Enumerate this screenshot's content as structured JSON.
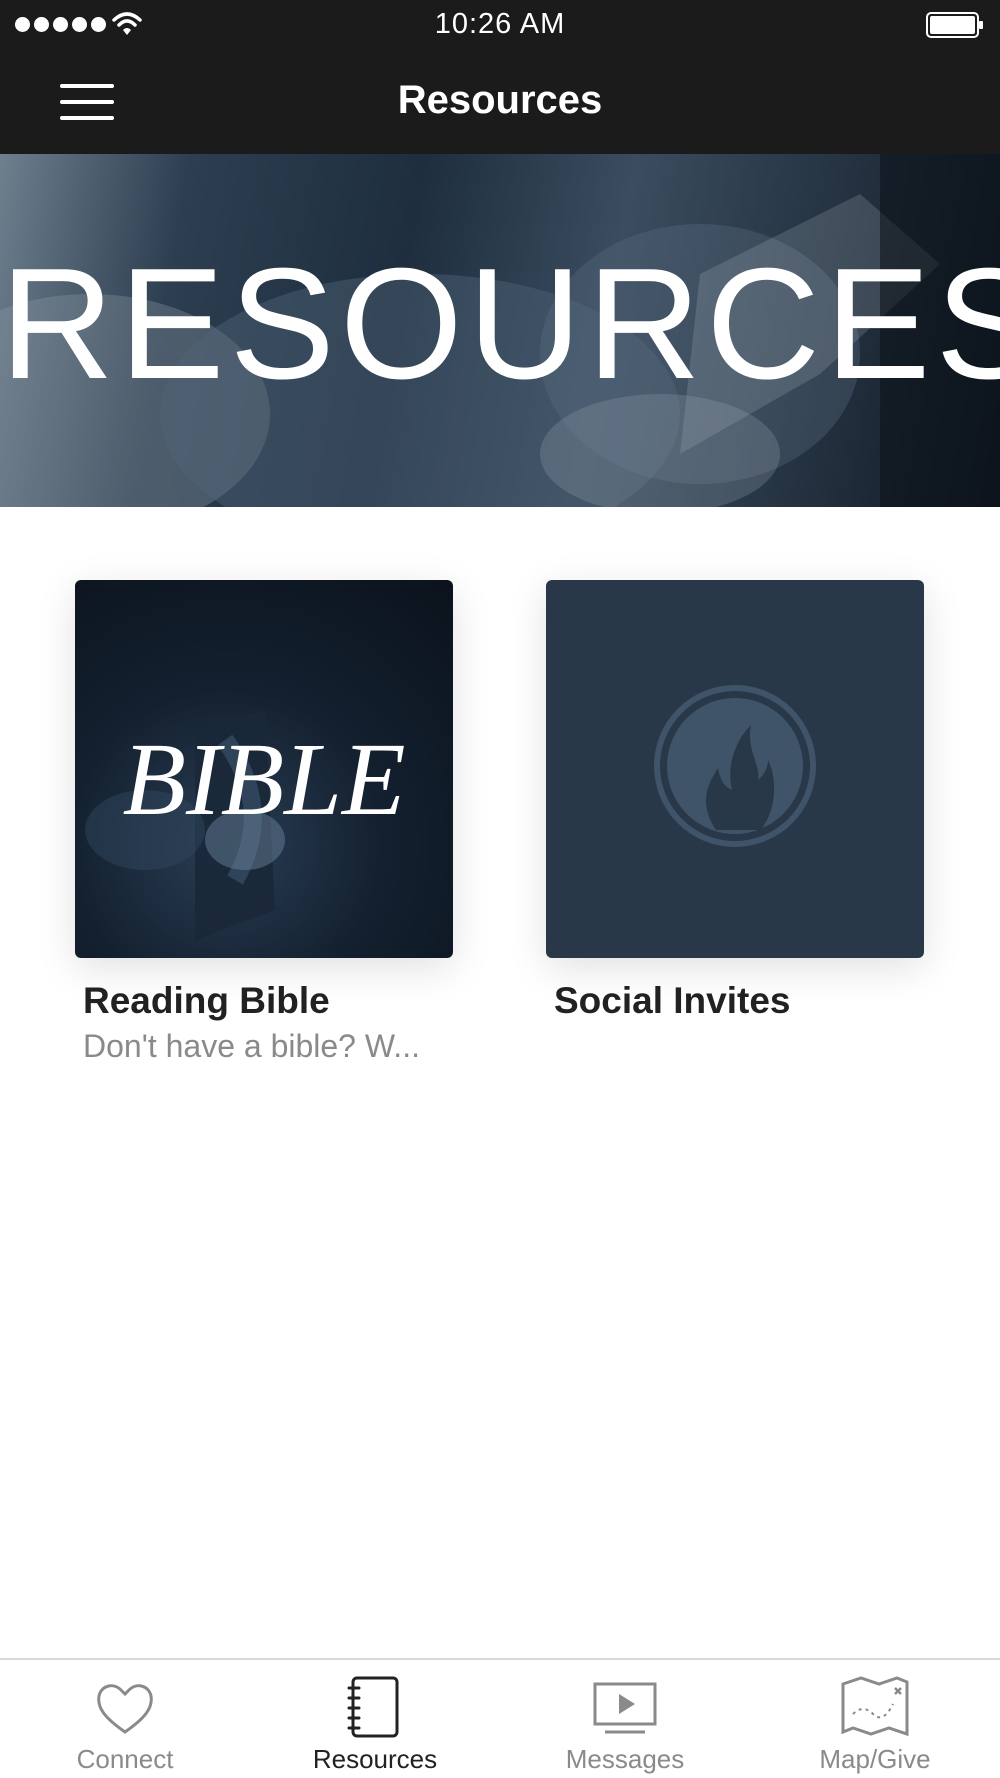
{
  "status_bar": {
    "time": "10:26 AM",
    "signal_bars": 5,
    "icons": [
      "signal-dots",
      "wifi-icon",
      "battery-icon"
    ]
  },
  "nav": {
    "title": "Resources",
    "menu_icon": "hamburger-icon"
  },
  "hero": {
    "text": "RESOURCES"
  },
  "cards": [
    {
      "image_text": "BIBLE",
      "title": "Reading Bible",
      "subtitle": "Don't have a bible? W..."
    },
    {
      "image_icon": "flame-seal-icon",
      "title": "Social Invites",
      "subtitle": ""
    }
  ],
  "tabs": [
    {
      "label": "Connect",
      "icon": "heart-icon",
      "active": false
    },
    {
      "label": "Resources",
      "icon": "notebook-icon",
      "active": true
    },
    {
      "label": "Messages",
      "icon": "video-play-icon",
      "active": false
    },
    {
      "label": "Map/Give",
      "icon": "map-icon",
      "active": false
    }
  ],
  "colors": {
    "bar_background": "#1c1b1c",
    "active_tab": "#222222",
    "inactive_tab": "#8a8a8a",
    "social_tile": "#283848"
  }
}
